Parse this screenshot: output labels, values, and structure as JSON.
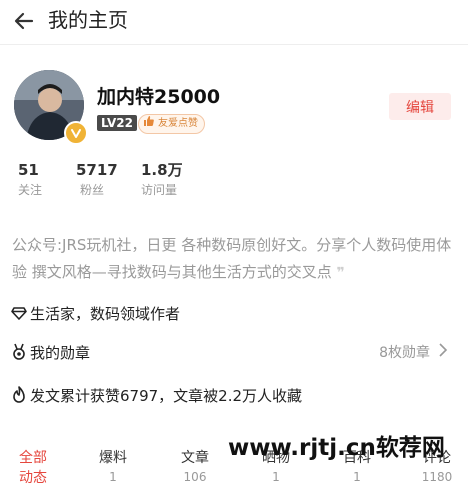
{
  "header": {
    "title": "我的主页",
    "back_icon": "arrow-left-icon"
  },
  "profile": {
    "name": "加内特25000",
    "level": "LV22",
    "friendly_badge": "友爱点赞",
    "edit_label": "编辑"
  },
  "stats": [
    {
      "value": "51",
      "label": "关注"
    },
    {
      "value": "5717",
      "label": "粉丝"
    },
    {
      "value": "1.8万",
      "label": "访问量"
    }
  ],
  "bio": "公众号:JRS玩机社，日更 各种数码原创好文。分享个人数码使用体验 撰文风格—寻找数码与其他生活方式的交叉点",
  "bio_quote": "❞",
  "identity": "生活家，数码领域作者",
  "medals": {
    "label": "我的勋章",
    "count": "8枚勋章"
  },
  "achievement": "发文累计获赞6797，文章被2.2万人收藏",
  "tabs": [
    {
      "label": "全部动态",
      "count": ""
    },
    {
      "label": "爆料",
      "count": "1"
    },
    {
      "label": "文章",
      "count": "106"
    },
    {
      "label": "晒物",
      "count": "1"
    },
    {
      "label": "百科",
      "count": "1"
    },
    {
      "label": "评论",
      "count": "1180"
    }
  ],
  "watermark": "www.rjtj.cn软荐网",
  "colors": {
    "accent": "#e5473e",
    "badge_gold": "#f0b336"
  }
}
